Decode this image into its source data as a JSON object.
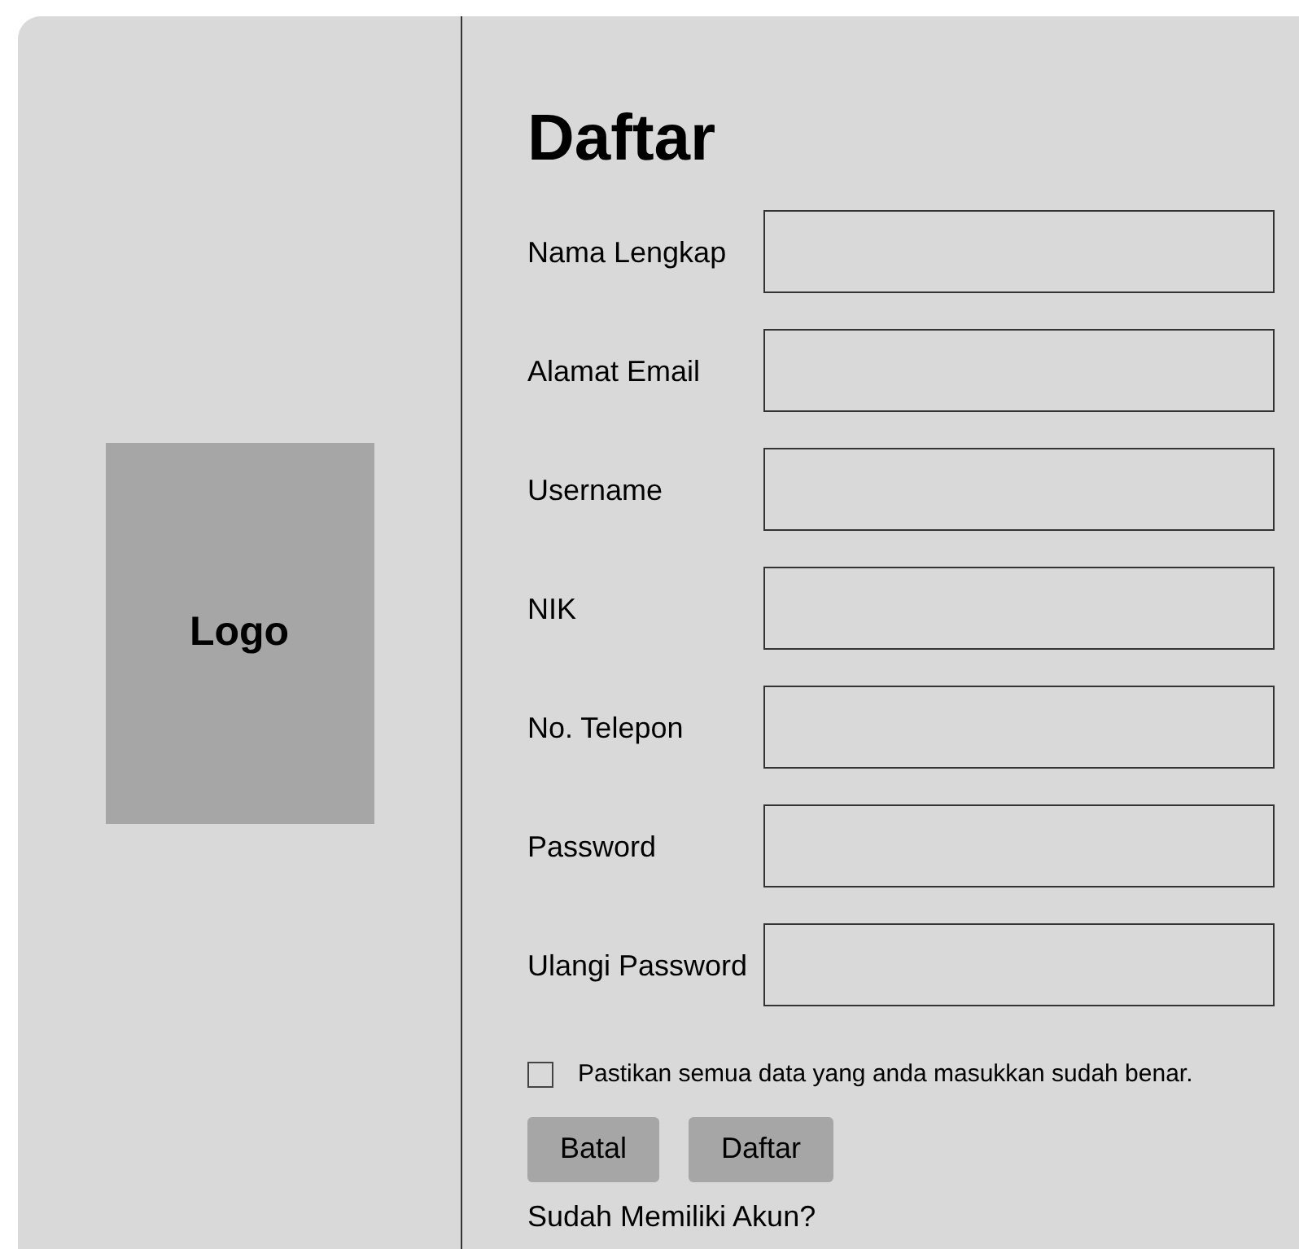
{
  "logo": {
    "text": "Logo"
  },
  "form": {
    "title": "Daftar",
    "fields": [
      {
        "label": "Nama Lengkap"
      },
      {
        "label": "Alamat Email"
      },
      {
        "label": "Username"
      },
      {
        "label": "NIK"
      },
      {
        "label": "No. Telepon"
      },
      {
        "label": "Password"
      },
      {
        "label": "Ulangi Password"
      }
    ],
    "confirm": {
      "label": "Pastikan semua data yang anda masukkan sudah benar.",
      "checked": false
    },
    "buttons": [
      "Batal",
      "Daftar"
    ],
    "login_link": "Sudah Memiliki Akun?"
  }
}
